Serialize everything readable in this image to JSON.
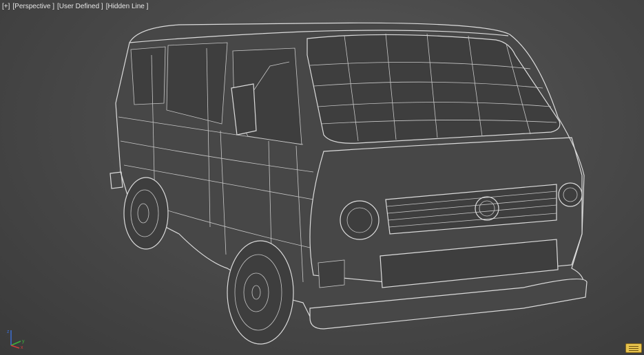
{
  "viewport": {
    "label_plus": "[+]",
    "label_view": "[Perspective ]",
    "label_shading_preset": "[User Defined ]",
    "label_shading": "[Hidden Line ]"
  },
  "axis": {
    "x": "x",
    "y": "y",
    "z": "z"
  },
  "colors": {
    "background_center": "#5a5a5a",
    "background_edge": "#3a3a3a",
    "wire": "#c8c8c8",
    "label_text": "#e6e6e6",
    "axis_x": "#d23c3c",
    "axis_y": "#3cb43c",
    "axis_z": "#3c6ed2"
  }
}
